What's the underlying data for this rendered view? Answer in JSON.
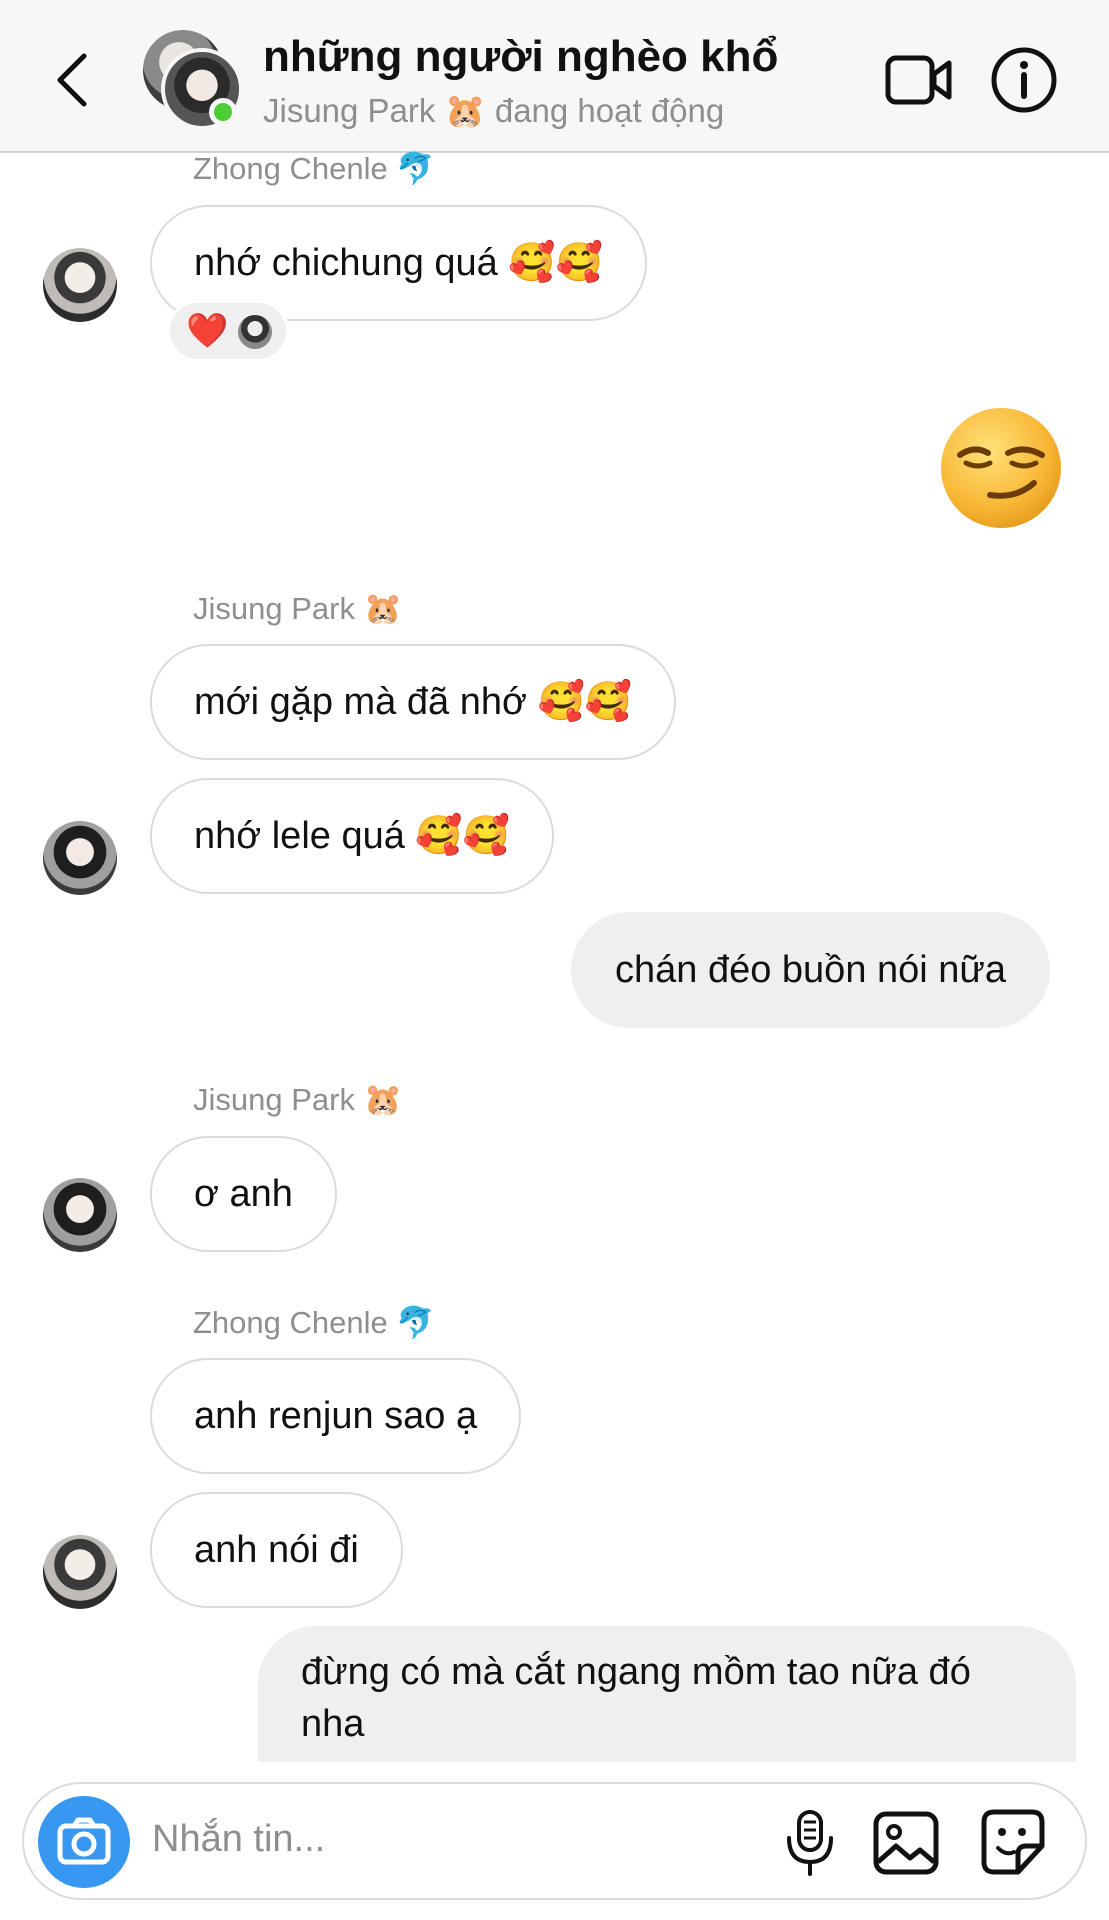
{
  "header": {
    "back_icon": "chevron-left-icon",
    "title": "những người nghèo khổ",
    "subtitle": "Jisung Park 🐹 đang hoạt động",
    "video_icon": "video-camera-icon",
    "info_icon": "info-icon",
    "online_color": "#4ccd36"
  },
  "messages": [
    {
      "sender": "Zhong Chenle 🐬",
      "text": "nhớ chichung quá 🥰🥰",
      "reactions": [
        "❤️"
      ]
    },
    {
      "outgoing": true,
      "emoji": "😏"
    },
    {
      "sender": "Jisung Park 🐹",
      "text": "mới gặp mà đã nhớ 🥰🥰"
    },
    {
      "text": "nhớ lele quá 🥰🥰"
    },
    {
      "outgoing": true,
      "text": "chán đéo buồn nói nữa"
    },
    {
      "sender": "Jisung Park 🐹",
      "text": "ơ anh"
    },
    {
      "sender": "Zhong Chenle 🐬",
      "text": "anh renjun sao ạ"
    },
    {
      "text": "anh nói đi"
    },
    {
      "outgoing": true,
      "text": "đừng có mà cắt ngang mồm tao nữa đó nha"
    }
  ],
  "composer": {
    "placeholder": "Nhắn tin...",
    "camera_icon": "camera-icon",
    "mic_icon": "microphone-icon",
    "image_icon": "image-icon",
    "sticker_icon": "sticker-icon",
    "accent": "#3897f0"
  },
  "colors": {
    "incoming_border": "#dbdbdb",
    "outgoing_bg": "#efefef",
    "muted_text": "#8e8e8e"
  }
}
